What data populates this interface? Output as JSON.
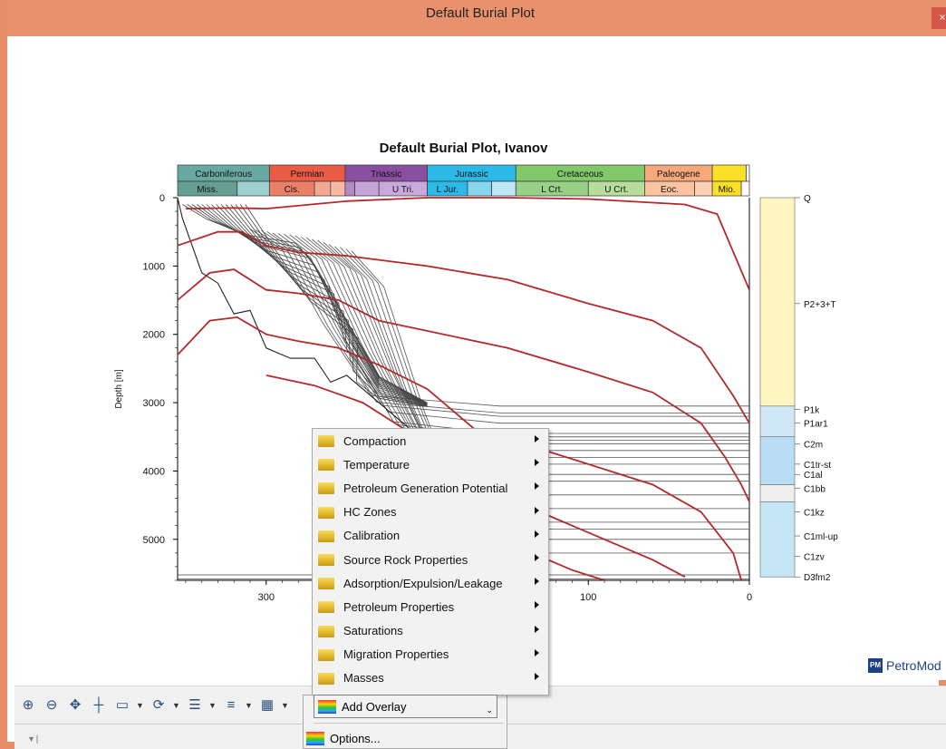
{
  "window": {
    "title": "Default Burial Plot",
    "close_glyph": "×"
  },
  "chart_data": {
    "type": "line",
    "title": "Default Burial Plot, Ivanov",
    "ylabel": "Depth [m]",
    "xlabel": "",
    "x_axis": "age, reversed",
    "xlim": [
      355,
      0
    ],
    "ylim": [
      0,
      5600
    ],
    "x_ticks": [
      300,
      100,
      0
    ],
    "y_ticks": [
      0,
      1000,
      2000,
      3000,
      4000,
      5000
    ],
    "periods": [
      {
        "name": "Carboniferous",
        "from": 355,
        "to": 298,
        "color": "#67a9a0"
      },
      {
        "name": "Permian",
        "from": 298,
        "to": 251,
        "color": "#ea5c45"
      },
      {
        "name": "Triassic",
        "from": 251,
        "to": 200,
        "color": "#8a4fa0"
      },
      {
        "name": "Jurassic",
        "from": 200,
        "to": 145,
        "color": "#2bb9e8"
      },
      {
        "name": "Cretaceous",
        "from": 145,
        "to": 65,
        "color": "#80c868"
      },
      {
        "name": "Paleogene",
        "from": 65,
        "to": 23,
        "color": "#f6a87a"
      },
      {
        "name": "",
        "from": 23,
        "to": 2,
        "color": "#fbe028"
      },
      {
        "name": "",
        "from": 2,
        "to": 0,
        "color": "#ffffff"
      }
    ],
    "epochs": [
      {
        "name": "Miss.",
        "from": 355,
        "to": 318,
        "color": "#669e94"
      },
      {
        "name": "",
        "from": 318,
        "to": 298,
        "color": "#9ecfd0"
      },
      {
        "name": "Cis.",
        "from": 298,
        "to": 270,
        "color": "#eb8068"
      },
      {
        "name": "",
        "from": 270,
        "to": 260,
        "color": "#f3a892"
      },
      {
        "name": "",
        "from": 260,
        "to": 251,
        "color": "#f7b8a4"
      },
      {
        "name": "",
        "from": 251,
        "to": 245,
        "color": "#b48ac6"
      },
      {
        "name": "",
        "from": 245,
        "to": 230,
        "color": "#c6a6d4"
      },
      {
        "name": "U Tri.",
        "from": 230,
        "to": 200,
        "color": "#c9a8dc"
      },
      {
        "name": "L Jur.",
        "from": 200,
        "to": 175,
        "color": "#2bb9e8"
      },
      {
        "name": "",
        "from": 175,
        "to": 160,
        "color": "#88d5ee"
      },
      {
        "name": "",
        "from": 160,
        "to": 145,
        "color": "#bde6f6"
      },
      {
        "name": "L Crt.",
        "from": 145,
        "to": 100,
        "color": "#98d088"
      },
      {
        "name": "U Crt.",
        "from": 100,
        "to": 65,
        "color": "#b6dd9c"
      },
      {
        "name": "Eoc.",
        "from": 65,
        "to": 34,
        "color": "#fbc3a0"
      },
      {
        "name": "",
        "from": 34,
        "to": 23,
        "color": "#fbd0b4"
      },
      {
        "name": "Mio.",
        "from": 23,
        "to": 5,
        "color": "#fbe028"
      },
      {
        "name": "",
        "from": 5,
        "to": 0,
        "color": "#ffffff"
      }
    ],
    "isotherms": [
      {
        "points": [
          [
            350,
            0.16
          ],
          [
            320,
            0.15
          ],
          [
            300,
            0.16
          ],
          [
            250,
            0.05
          ],
          [
            200,
            0.0
          ],
          [
            150,
            0.0
          ],
          [
            100,
            0.02
          ],
          [
            40,
            0.1
          ],
          [
            20,
            0.24
          ],
          [
            0,
            1.35
          ]
        ]
      },
      {
        "points": [
          [
            355,
            0.7
          ],
          [
            330,
            0.5
          ],
          [
            315,
            0.5
          ],
          [
            300,
            0.7
          ],
          [
            280,
            0.8
          ],
          [
            250,
            0.85
          ],
          [
            200,
            1.0
          ],
          [
            150,
            1.2
          ],
          [
            100,
            1.55
          ],
          [
            60,
            1.8
          ],
          [
            30,
            2.2
          ],
          [
            10,
            2.9
          ],
          [
            0,
            3.3
          ]
        ]
      },
      {
        "points": [
          [
            355,
            1.5
          ],
          [
            335,
            1.1
          ],
          [
            320,
            1.05
          ],
          [
            300,
            1.35
          ],
          [
            280,
            1.4
          ],
          [
            255,
            1.5
          ],
          [
            230,
            1.8
          ],
          [
            150,
            2.2
          ],
          [
            100,
            2.55
          ],
          [
            60,
            2.85
          ],
          [
            30,
            3.3
          ],
          [
            15,
            3.8
          ],
          [
            5,
            4.2
          ],
          [
            0,
            4.45
          ]
        ]
      },
      {
        "points": [
          [
            355,
            2.3
          ],
          [
            335,
            1.8
          ],
          [
            318,
            1.75
          ],
          [
            300,
            2.0
          ],
          [
            280,
            2.1
          ],
          [
            255,
            2.2
          ],
          [
            230,
            2.45
          ],
          [
            200,
            2.8
          ],
          [
            170,
            3.4
          ],
          [
            120,
            3.75
          ],
          [
            60,
            4.2
          ],
          [
            30,
            4.6
          ],
          [
            10,
            5.2
          ],
          [
            5,
            5.6
          ]
        ]
      },
      {
        "points": [
          [
            300,
            2.6
          ],
          [
            270,
            2.75
          ],
          [
            240,
            3.0
          ],
          [
            200,
            3.6
          ],
          [
            170,
            4.15
          ],
          [
            130,
            4.6
          ],
          [
            90,
            5.0
          ],
          [
            60,
            5.3
          ],
          [
            40,
            5.55
          ]
        ]
      },
      {
        "points": [
          [
            230,
            3.5
          ],
          [
            200,
            4.0
          ],
          [
            170,
            4.7
          ],
          [
            140,
            5.15
          ],
          [
            110,
            5.45
          ],
          [
            90,
            5.6
          ]
        ]
      }
    ],
    "side_column": [
      "Q",
      "P2+3+T",
      "P1k",
      "P1ar1",
      "C2m",
      "C1tr-st",
      "C1al",
      "C1bb",
      "C1kz",
      "C1ml-up",
      "C1zv",
      "D3fm2"
    ]
  },
  "context_menu": {
    "items": [
      {
        "label": "Compaction"
      },
      {
        "label": "Temperature"
      },
      {
        "label": "Petroleum Generation Potential"
      },
      {
        "label": "HC Zones"
      },
      {
        "label": "Calibration"
      },
      {
        "label": "Source Rock Properties"
      },
      {
        "label": "Adsorption/Expulsion/Leakage"
      },
      {
        "label": "Petroleum Properties"
      },
      {
        "label": "Saturations"
      },
      {
        "label": "Migration Properties"
      },
      {
        "label": "Masses"
      }
    ]
  },
  "overlay_menu": {
    "add_overlay": "Add Overlay",
    "options": "Options..."
  },
  "toolbar": {
    "icons": [
      "zoom-in-icon",
      "zoom-out-icon",
      "pan-icon",
      "crosshair-icon",
      "rectangle-select-icon",
      "magnet-icon",
      "layers-icon",
      "line-style-icon",
      "overlay-icon"
    ]
  },
  "branding": {
    "logo_text": "PM",
    "name": "PetroMod"
  }
}
